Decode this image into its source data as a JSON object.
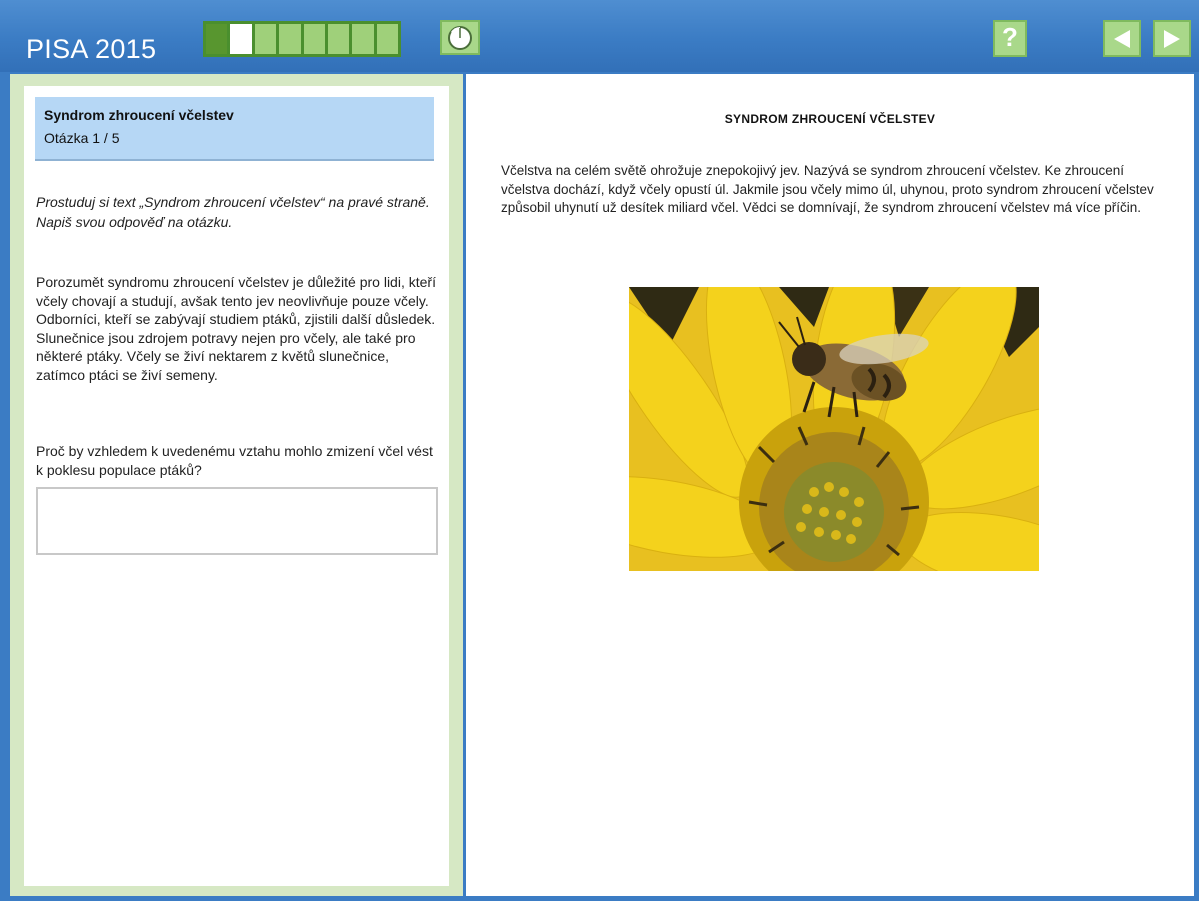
{
  "app": {
    "title": "PISA 2015"
  },
  "progress": {
    "total": 8,
    "completed": 1,
    "current": 2
  },
  "toolbar": {
    "help_label": "?",
    "timer_icon": "timer-icon",
    "prev_icon": "arrow-left-icon",
    "next_icon": "arrow-right-icon"
  },
  "colors": {
    "topbar": "#3b7cc4",
    "button_green": "#a9d88a",
    "question_header": "#b6d7f5",
    "left_frame": "#d6e8c4"
  },
  "question": {
    "title": "Syndrom zhroucení včelstev",
    "number": "Otázka 1 / 5",
    "instructions": "Prostuduj si text „Syndrom zhroucení včelstev“ na pravé straně. Napiš svou odpověď na otázku.",
    "body": "Porozumět syndromu zhroucení včelstev je důležité pro lidi, kteří včely chovají a studují, avšak tento jev neovlivňuje pouze včely. Odborníci, kteří se zabývají studiem ptáků, zjistili další důsledek. Slunečnice jsou zdrojem potravy nejen pro včely, ale také pro některé ptáky. Včely se živí nektarem z květů slunečnice, zatímco ptáci se živí semeny.",
    "prompt": "Proč by vzhledem k uvedenému vztahu mohlo zmizení včel vést k poklesu populace ptáků?",
    "answer_value": ""
  },
  "article": {
    "title": "SYNDROM ZHROUCENÍ VČELSTEV",
    "text": "Včelstva na celém světě ohrožuje znepokojivý jev. Nazývá se syndrom zhroucení včelstev. Ke zhroucení včelstva dochází, když včely opustí úl. Jakmile jsou včely mimo úl, uhynou, proto syndrom zhroucení včelstev způsobil uhynutí už desítek miliard včel. Vědci se domnívají, že syndrom zhroucení včelstev má více příčin.",
    "image": "bee-on-sunflower-photo"
  }
}
